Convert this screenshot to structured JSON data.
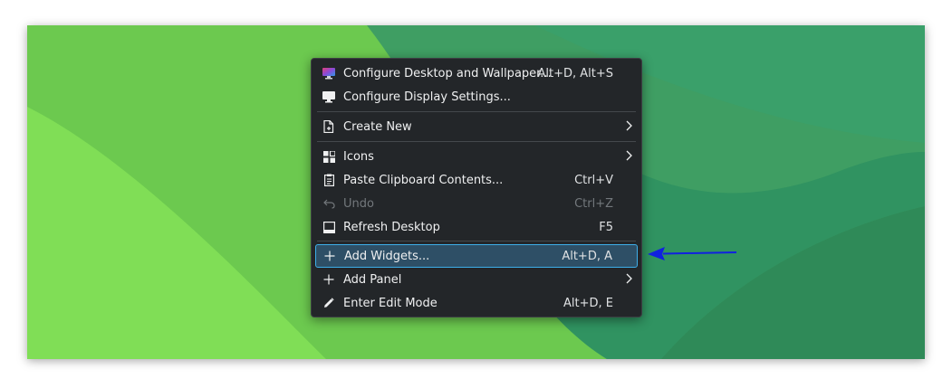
{
  "menu": {
    "groups": [
      [
        {
          "label": "Configure Desktop and Wallpaper...",
          "shortcut": "Alt+D, Alt+S",
          "icon": "monitor-color-icon"
        },
        {
          "label": "Configure Display Settings...",
          "shortcut": "",
          "icon": "display-icon"
        }
      ],
      [
        {
          "label": "Create New",
          "shortcut": "",
          "icon": "new-file-icon",
          "submenu": true
        }
      ],
      [
        {
          "label": "Icons",
          "shortcut": "",
          "icon": "grid-icon",
          "submenu": true
        },
        {
          "label": "Paste Clipboard Contents...",
          "shortcut": "Ctrl+V",
          "icon": "clipboard-icon"
        },
        {
          "label": "Undo",
          "shortcut": "Ctrl+Z",
          "icon": "undo-icon",
          "disabled": true
        },
        {
          "label": "Refresh Desktop",
          "shortcut": "F5",
          "icon": "refresh-desktop-icon"
        }
      ],
      [
        {
          "label": "Add Widgets...",
          "shortcut": "Alt+D, A",
          "icon": "plus-icon",
          "highlighted": true
        },
        {
          "label": "Add Panel",
          "shortcut": "",
          "icon": "plus-icon",
          "submenu": true
        },
        {
          "label": "Enter Edit Mode",
          "shortcut": "Alt+D, E",
          "icon": "pencil-icon"
        }
      ]
    ]
  },
  "colors": {
    "menu_bg": "#232629",
    "highlight_bg": "#2e4f66",
    "highlight_border": "#3daee9",
    "annotation_arrow": "#1020e0"
  }
}
